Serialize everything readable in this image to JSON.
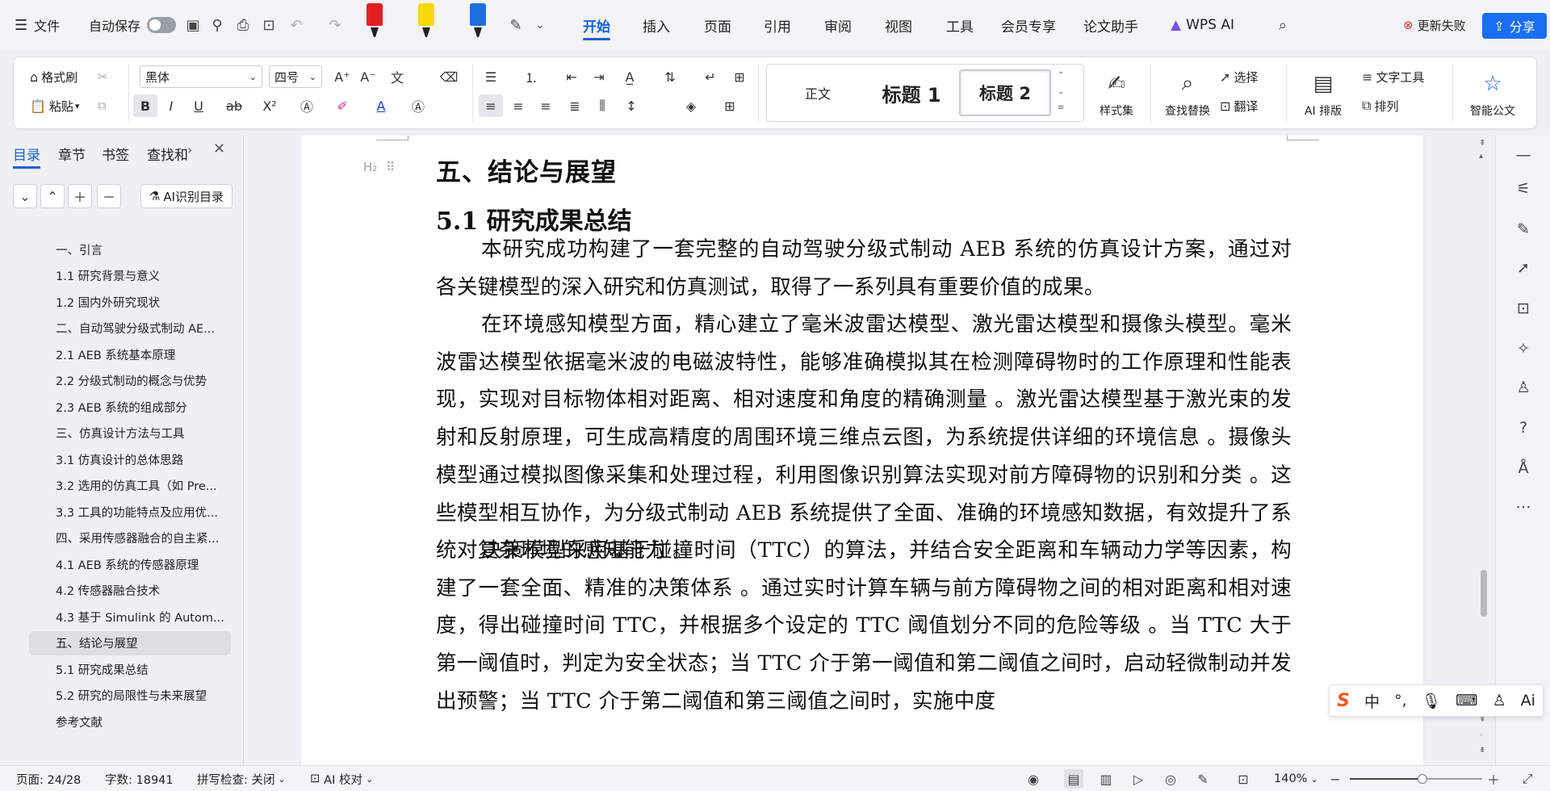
{
  "topbar": {
    "file_label": "文件",
    "autosave_label": "自动保存",
    "tabs": [
      "开始",
      "插入",
      "页面",
      "引用",
      "审阅",
      "视图",
      "工具",
      "会员专享",
      "论文助手"
    ],
    "wps_ai_label": "WPS AI",
    "update_label": "更新失败",
    "share_label": "分享"
  },
  "ribbon": {
    "format_painter": "格式刷",
    "paste": "粘贴",
    "font_family": "黑体",
    "font_size": "四号",
    "styles": [
      "正文",
      "标题 1",
      "标题 2"
    ],
    "styles_set": "样式集",
    "find_replace": "查找替换",
    "select": "选择",
    "translate": "翻译",
    "ai_layout": "AI 排版",
    "text_tools": "文字工具",
    "arrange": "排列",
    "smart_doc": "智能公文"
  },
  "nav": {
    "tabs": [
      "目录",
      "章节",
      "书签",
      "查找和"
    ],
    "ai_toc_label": "AI识别目录",
    "toc": [
      "一、引言",
      "1.1 研究背景与意义",
      "1.2 国内外研究现状",
      "二、自动驾驶分级式制动 AE...",
      "2.1 AEB 系统基本原理",
      "2.2 分级式制动的概念与优势",
      "2.3 AEB 系统的组成部分",
      "三、仿真设计方法与工具",
      "3.1 仿真设计的总体思路",
      "3.2 选用的仿真工具（如 Pre...",
      "3.3 工具的功能特点及应用优...",
      "四、采用传感器融合的自主紧...",
      "4.1 AEB 系统的传感器原理",
      "4.2 传感器融合技术",
      "4.3 基于 Simulink 的 Autom...",
      "五、结论与展望",
      "5.1 研究成果总结",
      "5.2 研究的局限性与未来展望",
      "参考文献"
    ],
    "selected_index": 15
  },
  "document": {
    "heading_marker": "H₂",
    "h1": "五、结论与展望",
    "h2": "5.1 研究成果总结",
    "p1": "本研究成功构建了一套完整的自动驾驶分级式制动 AEB 系统的仿真设计方案，通过对各关键模型的深入研究和仿真测试，取得了一系列具有重要价值的成果。",
    "p2": "在环境感知模型方面，精心建立了毫米波雷达模型、激光雷达模型和摄像头模型。毫米波雷达模型依据毫米波的电磁波特性，能够准确模拟其在检测障碍物时的工作原理和性能表现，实现对目标物体相对距离、相对速度和角度的精确测量 。激光雷达模型基于激光束的发射和反射原理，可生成高精度的周围环境三维点云图，为系统提供详细的环境信息 。摄像头模型通过模拟图像采集和处理过程，利用图像识别算法实现对前方障碍物的识别和分类 。这些模型相互协作，为分级式制动 AEB 系统提供了全面、准确的环境感知数据，有效提升了系统对复杂环境的感知能力 。",
    "p3": "决策模型采用基于碰撞时间（TTC）的算法，并结合安全距离和车辆动力学等因素，构建了一套全面、精准的决策体系 。通过实时计算车辆与前方障碍物之间的相对距离和相对速度，得出碰撞时间 TTC，并根据多个设定的 TTC 阈值划分不同的危险等级 。当 TTC 大于第一阈值时，判定为安全状态；当 TTC 介于第一阈值和第二阈值之间时，启动轻微制动并发出预警；当 TTC 介于第二阈值和第三阈值之间时，实施中度"
  },
  "ime": {
    "mode": "中",
    "ai_label": "Ai"
  },
  "status": {
    "page": "页面: 24/28",
    "words": "字数: 18941",
    "spellcheck": "拼写检查: 关闭",
    "ai_proof": "AI 校对",
    "zoom": "140%",
    "zoom_fraction": 0.55
  },
  "colors": {
    "accent": "#1a5fd8",
    "share": "#1a6ef5",
    "marker_red": "#e02020",
    "marker_yellow": "#f5d90a",
    "marker_blue": "#1e6fd9"
  }
}
